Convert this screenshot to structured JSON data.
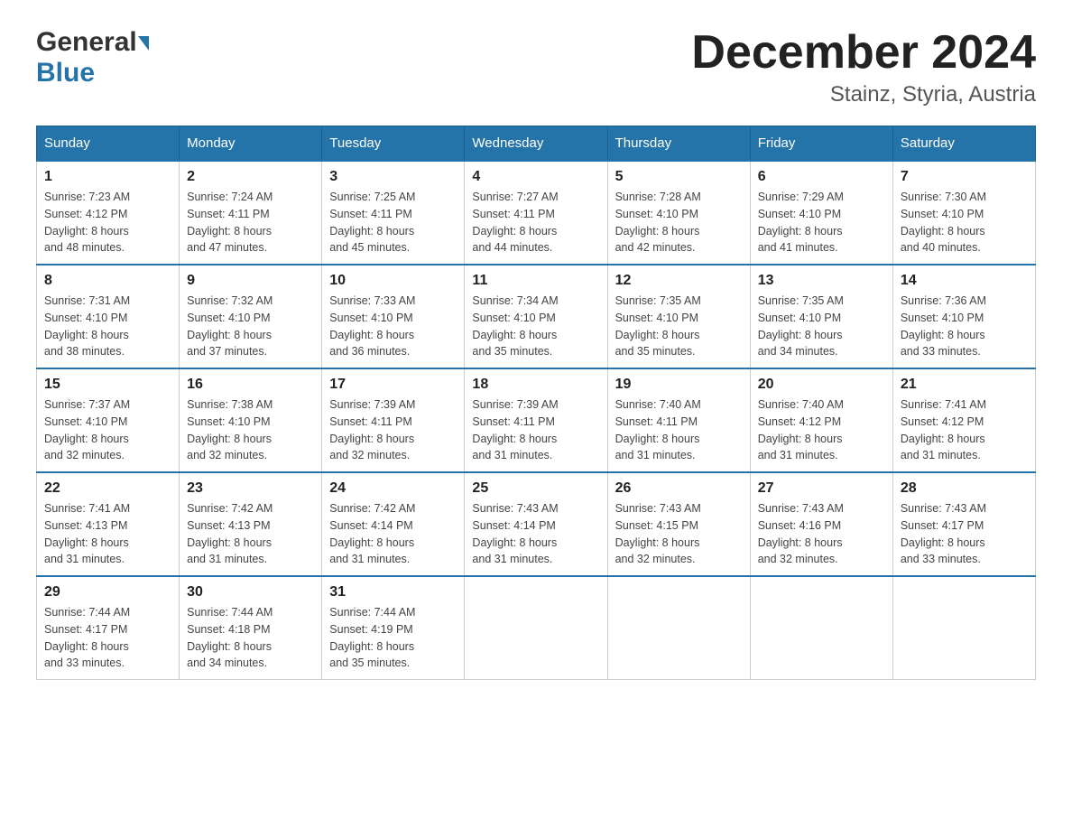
{
  "header": {
    "logo_general": "General",
    "logo_blue": "Blue",
    "title": "December 2024",
    "location": "Stainz, Styria, Austria"
  },
  "columns": [
    "Sunday",
    "Monday",
    "Tuesday",
    "Wednesday",
    "Thursday",
    "Friday",
    "Saturday"
  ],
  "weeks": [
    [
      {
        "day": "1",
        "sunrise": "7:23 AM",
        "sunset": "4:12 PM",
        "daylight": "8 hours and 48 minutes."
      },
      {
        "day": "2",
        "sunrise": "7:24 AM",
        "sunset": "4:11 PM",
        "daylight": "8 hours and 47 minutes."
      },
      {
        "day": "3",
        "sunrise": "7:25 AM",
        "sunset": "4:11 PM",
        "daylight": "8 hours and 45 minutes."
      },
      {
        "day": "4",
        "sunrise": "7:27 AM",
        "sunset": "4:11 PM",
        "daylight": "8 hours and 44 minutes."
      },
      {
        "day": "5",
        "sunrise": "7:28 AM",
        "sunset": "4:10 PM",
        "daylight": "8 hours and 42 minutes."
      },
      {
        "day": "6",
        "sunrise": "7:29 AM",
        "sunset": "4:10 PM",
        "daylight": "8 hours and 41 minutes."
      },
      {
        "day": "7",
        "sunrise": "7:30 AM",
        "sunset": "4:10 PM",
        "daylight": "8 hours and 40 minutes."
      }
    ],
    [
      {
        "day": "8",
        "sunrise": "7:31 AM",
        "sunset": "4:10 PM",
        "daylight": "8 hours and 38 minutes."
      },
      {
        "day": "9",
        "sunrise": "7:32 AM",
        "sunset": "4:10 PM",
        "daylight": "8 hours and 37 minutes."
      },
      {
        "day": "10",
        "sunrise": "7:33 AM",
        "sunset": "4:10 PM",
        "daylight": "8 hours and 36 minutes."
      },
      {
        "day": "11",
        "sunrise": "7:34 AM",
        "sunset": "4:10 PM",
        "daylight": "8 hours and 35 minutes."
      },
      {
        "day": "12",
        "sunrise": "7:35 AM",
        "sunset": "4:10 PM",
        "daylight": "8 hours and 35 minutes."
      },
      {
        "day": "13",
        "sunrise": "7:35 AM",
        "sunset": "4:10 PM",
        "daylight": "8 hours and 34 minutes."
      },
      {
        "day": "14",
        "sunrise": "7:36 AM",
        "sunset": "4:10 PM",
        "daylight": "8 hours and 33 minutes."
      }
    ],
    [
      {
        "day": "15",
        "sunrise": "7:37 AM",
        "sunset": "4:10 PM",
        "daylight": "8 hours and 32 minutes."
      },
      {
        "day": "16",
        "sunrise": "7:38 AM",
        "sunset": "4:10 PM",
        "daylight": "8 hours and 32 minutes."
      },
      {
        "day": "17",
        "sunrise": "7:39 AM",
        "sunset": "4:11 PM",
        "daylight": "8 hours and 32 minutes."
      },
      {
        "day": "18",
        "sunrise": "7:39 AM",
        "sunset": "4:11 PM",
        "daylight": "8 hours and 31 minutes."
      },
      {
        "day": "19",
        "sunrise": "7:40 AM",
        "sunset": "4:11 PM",
        "daylight": "8 hours and 31 minutes."
      },
      {
        "day": "20",
        "sunrise": "7:40 AM",
        "sunset": "4:12 PM",
        "daylight": "8 hours and 31 minutes."
      },
      {
        "day": "21",
        "sunrise": "7:41 AM",
        "sunset": "4:12 PM",
        "daylight": "8 hours and 31 minutes."
      }
    ],
    [
      {
        "day": "22",
        "sunrise": "7:41 AM",
        "sunset": "4:13 PM",
        "daylight": "8 hours and 31 minutes."
      },
      {
        "day": "23",
        "sunrise": "7:42 AM",
        "sunset": "4:13 PM",
        "daylight": "8 hours and 31 minutes."
      },
      {
        "day": "24",
        "sunrise": "7:42 AM",
        "sunset": "4:14 PM",
        "daylight": "8 hours and 31 minutes."
      },
      {
        "day": "25",
        "sunrise": "7:43 AM",
        "sunset": "4:14 PM",
        "daylight": "8 hours and 31 minutes."
      },
      {
        "day": "26",
        "sunrise": "7:43 AM",
        "sunset": "4:15 PM",
        "daylight": "8 hours and 32 minutes."
      },
      {
        "day": "27",
        "sunrise": "7:43 AM",
        "sunset": "4:16 PM",
        "daylight": "8 hours and 32 minutes."
      },
      {
        "day": "28",
        "sunrise": "7:43 AM",
        "sunset": "4:17 PM",
        "daylight": "8 hours and 33 minutes."
      }
    ],
    [
      {
        "day": "29",
        "sunrise": "7:44 AM",
        "sunset": "4:17 PM",
        "daylight": "8 hours and 33 minutes."
      },
      {
        "day": "30",
        "sunrise": "7:44 AM",
        "sunset": "4:18 PM",
        "daylight": "8 hours and 34 minutes."
      },
      {
        "day": "31",
        "sunrise": "7:44 AM",
        "sunset": "4:19 PM",
        "daylight": "8 hours and 35 minutes."
      },
      null,
      null,
      null,
      null
    ]
  ],
  "labels": {
    "sunrise": "Sunrise:",
    "sunset": "Sunset:",
    "daylight": "Daylight:"
  }
}
